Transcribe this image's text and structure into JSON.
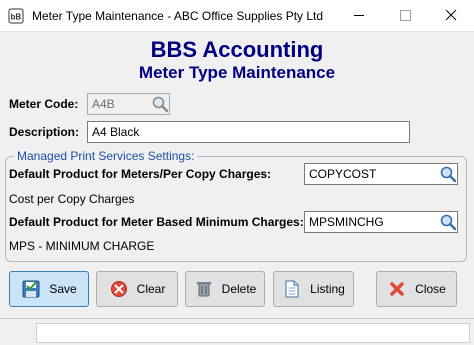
{
  "window": {
    "title": "Meter Type Maintenance - ABC Office Supplies Pty Ltd",
    "icon": "bbs-app-icon"
  },
  "header": {
    "app_name": "BBS Accounting",
    "form_title": "Meter Type Maintenance"
  },
  "form": {
    "meter_code_label": "Meter Code:",
    "meter_code_value": "A4B",
    "description_label": "Description:",
    "description_value": "A4 Black"
  },
  "mps": {
    "group_title": "Managed Print Services Settings:",
    "per_copy_label": "Default Product for Meters/Per Copy Charges:",
    "per_copy_value": "COPYCOST",
    "per_copy_desc": "Cost per Copy Charges",
    "min_label": "Default Product for Meter Based Minimum Charges:",
    "min_value": "MPSMINCHG",
    "min_desc": "MPS - MINIMUM CHARGE"
  },
  "buttons": {
    "save": "Save",
    "clear": "Clear",
    "delete": "Delete",
    "listing": "Listing",
    "close": "Close"
  },
  "colors": {
    "heading": "#000080",
    "group_title": "#1b4fa8",
    "default_button": "#cce4f7",
    "close_icon": "#e04a3a"
  }
}
